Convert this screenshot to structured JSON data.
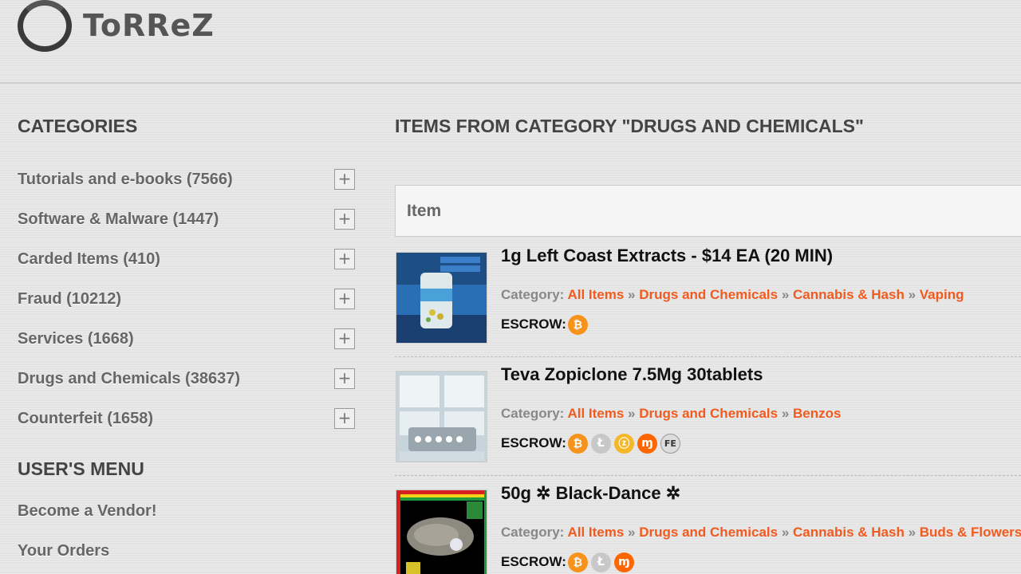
{
  "site": {
    "name": "ToRReZ"
  },
  "sidebar": {
    "categories_title": "CATEGORIES",
    "categories": [
      {
        "label": "Tutorials and e-books (7566)"
      },
      {
        "label": "Software & Malware (1447)"
      },
      {
        "label": "Carded Items (410)"
      },
      {
        "label": "Fraud (10212)"
      },
      {
        "label": "Services (1668)"
      },
      {
        "label": "Drugs and Chemicals (38637)"
      },
      {
        "label": "Counterfeit (1658)"
      }
    ],
    "expand_symbol": "+",
    "user_menu_title": "USER'S MENU",
    "user_menu": [
      {
        "label": "Become a Vendor!"
      },
      {
        "label": "Your Orders"
      }
    ]
  },
  "main": {
    "title": "ITEMS FROM CATEGORY \"DRUGS AND CHEMICALS\"",
    "table_header": "Item",
    "category_prefix": "Category:",
    "escrow_label": "ESCROW:",
    "breadcrumb_separator": "»",
    "items": [
      {
        "title": "1g Left Coast Extracts - $14 EA (20 MIN)",
        "category_path": [
          "All Items",
          "Drugs and Chemicals",
          "Cannabis & Hash",
          "Vaping"
        ],
        "escrow": [
          "bitcoin-icon"
        ]
      },
      {
        "title": "Teva Zopiclone 7.5Mg 30tablets",
        "category_path": [
          "All Items",
          "Drugs and Chemicals",
          "Benzos"
        ],
        "escrow": [
          "bitcoin-icon",
          "litecoin-icon",
          "zcash-icon",
          "monero-icon",
          "fe-icon"
        ]
      },
      {
        "title": "50g ✲ Black-Dance ✲",
        "category_path": [
          "All Items",
          "Drugs and Chemicals",
          "Cannabis & Hash",
          "Buds & Flowers"
        ],
        "escrow": [
          "bitcoin-icon",
          "litecoin-icon",
          "monero-icon"
        ]
      }
    ]
  },
  "coins": {
    "fe_label": "FE"
  },
  "colors": {
    "link": "#f25a1e",
    "bitcoin": "#f7931a",
    "monero": "#ff6600"
  }
}
